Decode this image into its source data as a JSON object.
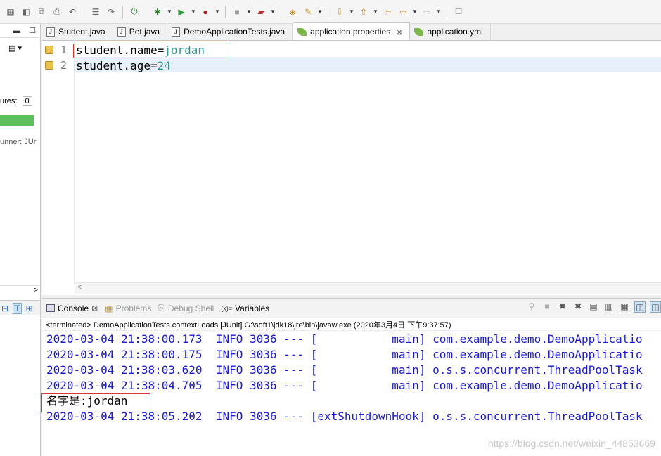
{
  "toolbar": {
    "icons": [
      "new",
      "save",
      "save-all",
      "print",
      "undo",
      "redo",
      "open-type",
      "skip-breakpoints",
      "debug",
      "run",
      "coverage",
      "stop",
      "external-tools",
      "open-task",
      "search",
      "next-annotation",
      "prev-annotation",
      "back",
      "forward",
      "open-perspective"
    ]
  },
  "left_panel": {
    "failures_label": "ures:",
    "failures_count": "0",
    "runner_label": "unner: JUr",
    "scroll_arrow": ">"
  },
  "editor": {
    "tabs": [
      {
        "label": "Student.java",
        "icon": "java-file-icon"
      },
      {
        "label": "Pet.java",
        "icon": "java-file-icon"
      },
      {
        "label": "DemoApplicationTests.java",
        "icon": "java-file-icon"
      },
      {
        "label": "application.properties",
        "icon": "leaf-icon",
        "active": true,
        "close": "⊠"
      },
      {
        "label": "application.yml",
        "icon": "leaf-icon"
      }
    ],
    "lines": [
      {
        "num": "1",
        "key": "student.name",
        "eq": "=",
        "value": "jordan"
      },
      {
        "num": "2",
        "key": "student.age",
        "eq": "=",
        "value": "24"
      }
    ],
    "hscroll_arrow": "<"
  },
  "console": {
    "tabs": [
      {
        "label": "Console",
        "close": "⊠",
        "active": true
      },
      {
        "label": "Problems"
      },
      {
        "label": "Debug Shell"
      },
      {
        "label": "Variables",
        "prefix": "(x)="
      }
    ],
    "terminated": "<terminated> DemoApplicationTests.contextLoads [JUnit] G:\\soft1\\jdk18\\jre\\bin\\javaw.exe (2020年3月4日 下午9:37:57)",
    "log_lines": [
      "2020-03-04 21:38:00.173  INFO 3036 --- [           main] com.example.demo.DemoApplicatio",
      "2020-03-04 21:38:00.175  INFO 3036 --- [           main] com.example.demo.DemoApplicatio",
      "2020-03-04 21:38:03.620  INFO 3036 --- [           main] o.s.s.concurrent.ThreadPoolTask",
      "2020-03-04 21:38:04.705  INFO 3036 --- [           main] com.example.demo.DemoApplicatio"
    ],
    "output_line": "名字是:jordan",
    "last_log_line": "2020-03-04 21:38:05.202  INFO 3036 --- [extShutdownHook] o.s.s.concurrent.ThreadPoolTask",
    "watermark": "https://blog.csdn.net/weixin_44853669"
  },
  "colors": {
    "value_teal": "#2a9a9a",
    "log_blue": "#1a1ad8",
    "highlight_red": "#e03535",
    "progress_green": "#5fbf5f"
  }
}
